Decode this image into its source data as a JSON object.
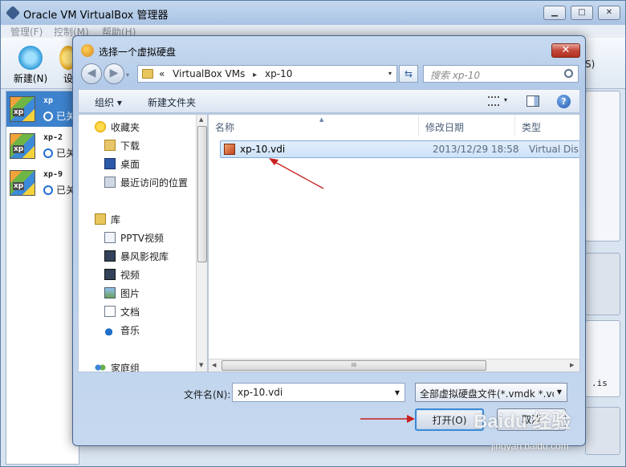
{
  "main_window": {
    "title": "Oracle VM VirtualBox 管理器",
    "controls": {
      "minimize": "▁",
      "maximize": "□",
      "close": "✕"
    },
    "menu": [
      "管理(F)",
      "控制(M)",
      "帮助(H)"
    ],
    "toolbar": {
      "new_label": "新建(N)",
      "settings_label": "设"
    },
    "vm_list": [
      {
        "name": "xp",
        "state": "已关",
        "os_badge": "xp"
      },
      {
        "name": "xp-2",
        "state": "已关",
        "os_badge": "xp"
      },
      {
        "name": "xp-9",
        "state": "已关",
        "os_badge": "xp"
      }
    ],
    "partial_right_text": "S)",
    "partial_right_text_2": ".is"
  },
  "dialog": {
    "title": "选择一个虚拟硬盘",
    "close_label": "✕",
    "nav": {
      "back": "◀",
      "forward": "▶",
      "dropdown": "▾"
    },
    "address": {
      "prefix": "«",
      "crumbs": [
        "VirtualBox VMs",
        "xp-10"
      ],
      "separator": "▸",
      "dropdown": "▾"
    },
    "refresh": "⇆",
    "search_placeholder": "搜索 xp-10",
    "commands": {
      "organize": "组织 ▾",
      "new_folder": "新建文件夹",
      "view_dd": "▾",
      "help": "?"
    },
    "nav_pane": {
      "favorites_header": "收藏夹",
      "favorites": [
        "下载",
        "桌面",
        "最近访问的位置"
      ],
      "libraries_header": "库",
      "libraries": [
        "PPTV视频",
        "暴风影视库",
        "视频",
        "图片",
        "文档",
        "音乐"
      ],
      "homegroup": "家庭组"
    },
    "columns": {
      "name": "名称",
      "date": "修改日期",
      "type": "类型"
    },
    "files": [
      {
        "name": "xp-10.vdi",
        "modified": "2013/12/29 18:58",
        "type": "Virtual Disk"
      }
    ],
    "filename_label": "文件名(N):",
    "filename_value": "xp-10.vdi",
    "filter_value": "全部虚拟硬盘文件(*.vmdk *.vd",
    "open_label": "打开(O)",
    "cancel_label": "取消",
    "scroll": {
      "up": "▲",
      "down": "▼",
      "left": "◀",
      "right": "▶",
      "grip": "III"
    }
  },
  "watermark": {
    "main": "Baidu 经验",
    "sub": "jingyan.baidu.com"
  },
  "colors": {
    "annotation_arrow": "#c8201e",
    "selection": "#3d82cc"
  }
}
